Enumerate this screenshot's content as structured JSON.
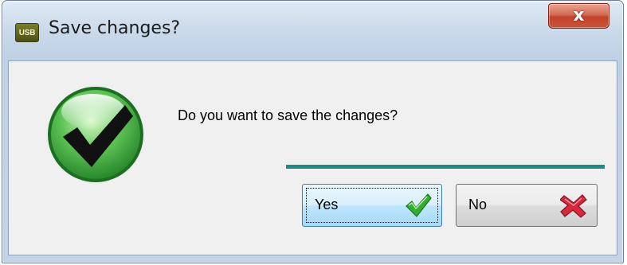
{
  "dialog": {
    "app_icon_text": "USB",
    "title": "Save changes?",
    "close_symbol": "x",
    "message": "Do you want to save the changes?",
    "icon": "green-check-circle-icon"
  },
  "buttons": {
    "yes_label": "Yes",
    "yes_icon": "green-check-icon",
    "no_label": "No",
    "no_icon": "red-x-icon"
  },
  "colors": {
    "divider": "#1a8c88",
    "check_green": "#2fae2f",
    "close_red": "#c2432a",
    "no_red": "#d8283a"
  }
}
